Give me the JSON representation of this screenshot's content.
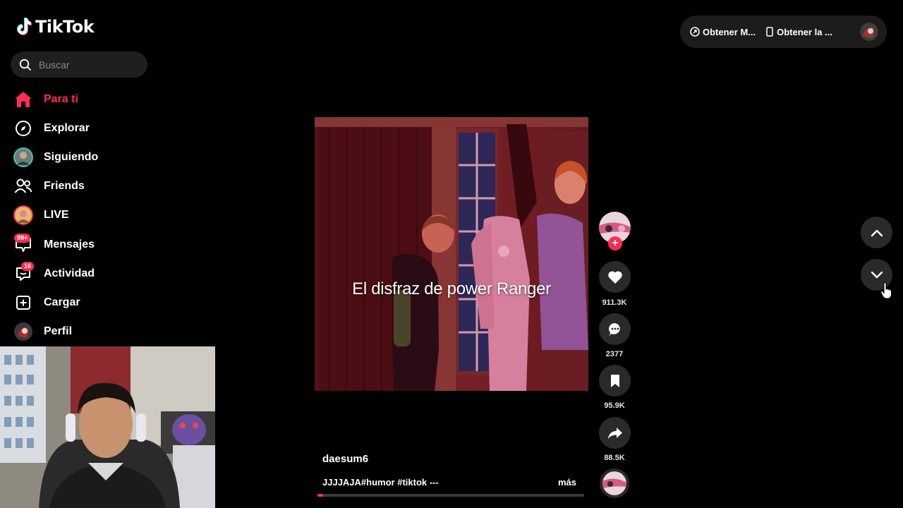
{
  "app": {
    "logo_text": "TikTok"
  },
  "search": {
    "placeholder": "Buscar"
  },
  "sidebar": {
    "items": [
      {
        "label": "Para ti",
        "icon": "home-icon",
        "active": true
      },
      {
        "label": "Explorar",
        "icon": "compass-icon"
      },
      {
        "label": "Siguiendo",
        "icon": "avatar"
      },
      {
        "label": "Friends",
        "icon": "friends-icon"
      },
      {
        "label": "LIVE",
        "icon": "live-avatar"
      },
      {
        "label": "Mensajes",
        "icon": "message-icon",
        "badge": "99+"
      },
      {
        "label": "Actividad",
        "icon": "inbox-icon",
        "badge": "16"
      },
      {
        "label": "Cargar",
        "icon": "plus-square-icon"
      },
      {
        "label": "Perfil",
        "icon": "avatar"
      }
    ]
  },
  "header": {
    "get_coins_label": "Obtener M...",
    "get_app_label": "Obtener la ..."
  },
  "video": {
    "caption": "El disfraz de power Ranger",
    "author": "daesum6",
    "description": "JJJJAJA#humor #tiktok ---",
    "more_label": "más",
    "progress": 0.02
  },
  "actions": {
    "likes": "911.3K",
    "comments": "2377",
    "saves": "95.9K",
    "shares": "88.5K"
  },
  "colors": {
    "accent": "#fe2c55",
    "background": "#000000",
    "button_bg": "#2a2a2a"
  }
}
